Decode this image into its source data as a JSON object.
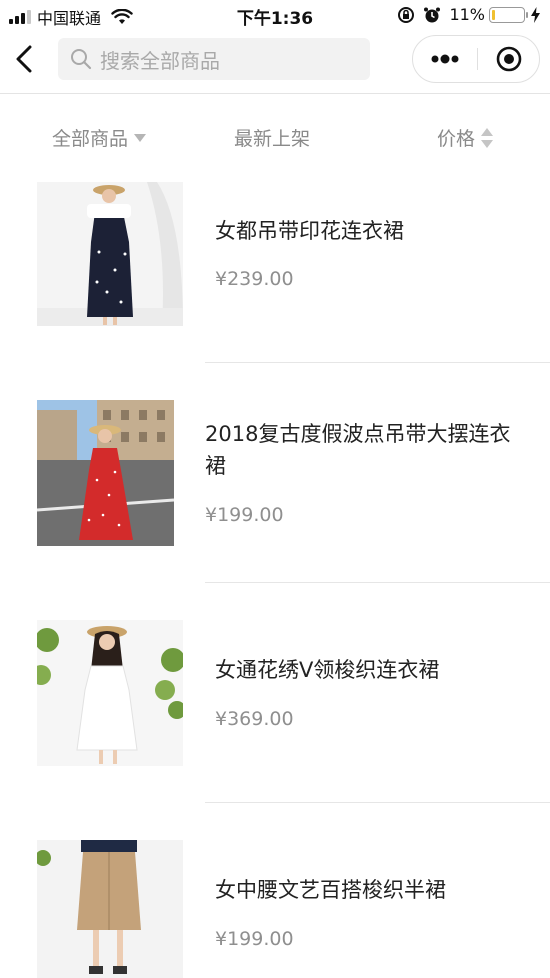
{
  "status_bar": {
    "carrier": "中国联通",
    "time": "下午1:36",
    "battery_percent": "11%",
    "battery_level": 0.11,
    "icons": [
      "signal-icon",
      "wifi-icon",
      "rotation-lock-icon",
      "alarm-icon",
      "battery-icon",
      "charging-icon"
    ]
  },
  "nav": {
    "search_placeholder": "搜索全部商品",
    "icons": [
      "back-arrow-icon",
      "search-icon",
      "more-dots-icon",
      "miniprogram-close-icon"
    ]
  },
  "filters": {
    "all_products": "全部商品",
    "newest": "最新上架",
    "price": "价格"
  },
  "products": [
    {
      "title": "女都吊带印花连衣裙",
      "price": "¥239.00",
      "image": "navy-floral-slip-dress-photo"
    },
    {
      "title": "2018复古度假波点吊带大摆连衣裙",
      "price": "¥199.00",
      "image": "red-polka-dot-dress-street-photo"
    },
    {
      "title": "女通花绣V领梭织连衣裙",
      "price": "¥369.00",
      "image": "white-embroidered-dress-photo"
    },
    {
      "title": "女中腰文艺百搭梭织半裙",
      "price": "¥199.00",
      "image": "khaki-midi-skirt-photo"
    }
  ],
  "colors": {
    "accent_battery": "#f0c030",
    "text_primary": "#222222",
    "text_secondary": "#8f8f8f"
  }
}
